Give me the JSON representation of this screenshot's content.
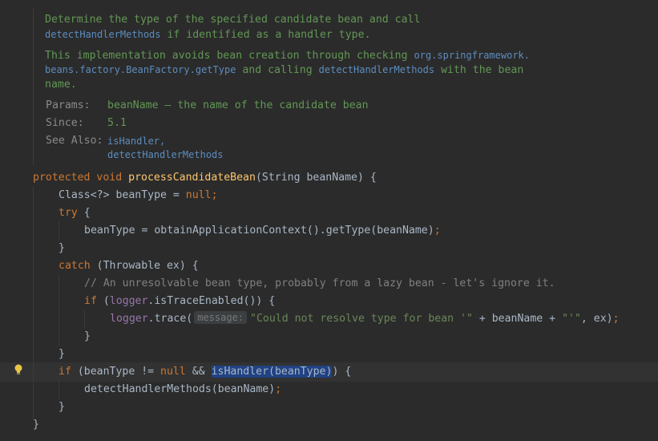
{
  "javadoc": {
    "line1": "Determine the type of the specified candidate bean and call",
    "line2_link": "detectHandlerMethods",
    "line2_text": " if identified as a handler type.",
    "line3_text": "This implementation avoids bean creation through checking ",
    "line3_link": "org.springframework.",
    "line4_link": "beans.factory.BeanFactory.getType",
    "line4_mid": " and calling ",
    "line4_link2": "detectHandlerMethods",
    "line4_end": " with the bean",
    "line5": "name.",
    "params_label": "Params:",
    "params_value": "beanName – the name of the candidate bean",
    "since_label": "Since:",
    "since_value": "5.1",
    "see_also_label": "See Also:",
    "see_also_1": "isHandler,",
    "see_also_2": "detectHandlerMethods"
  },
  "code": {
    "l1_kw1": "protected",
    "l1_kw2": "void",
    "l1_fn": "processCandidateBean",
    "l1_rest": "(String beanName) {",
    "l2_a": "Class<?> beanType = ",
    "l2_null": "null",
    "l2_semi": ";",
    "l3_try": "try",
    "l3_rest": " {",
    "l4_a": "beanType = obtainApplicationContext().getType(beanName)",
    "l4_semi": ";",
    "l5": "}",
    "l6_catch": "catch",
    "l6_rest": " (Throwable ex) {",
    "l7_comment": "// An unresolvable bean type, probably from a lazy bean - let's ignore it.",
    "l8_if": "if",
    "l8_a": " (",
    "l8_logger": "logger",
    "l8_b": ".isTraceEnabled()) {",
    "l9_logger": "logger",
    "l9_a": ".trace(",
    "l9_hint": "message:",
    "l9_str1": "\"Could not resolve type for bean '\"",
    "l9_b": " + beanName + ",
    "l9_str2": "\"'\"",
    "l9_c": ", ex)",
    "l9_semi": ";",
    "l10": "}",
    "l11": "}",
    "l12_if": "if",
    "l12_a": " (beanType != ",
    "l12_null": "null",
    "l12_b": " && ",
    "l12_hl": "isHandler(beanType)",
    "l12_c": ") {",
    "l13_a": "detectHandlerMethods(beanName)",
    "l13_semi": ";",
    "l14": "}",
    "l15": "}"
  },
  "colors": {
    "background": "#2b2b2b",
    "keyword": "#cc7832",
    "method_decl": "#ffc66d",
    "string": "#6a8759",
    "comment": "#808080",
    "field": "#9876aa",
    "doc_text": "#629755",
    "doc_link": "#5c8cbf"
  }
}
